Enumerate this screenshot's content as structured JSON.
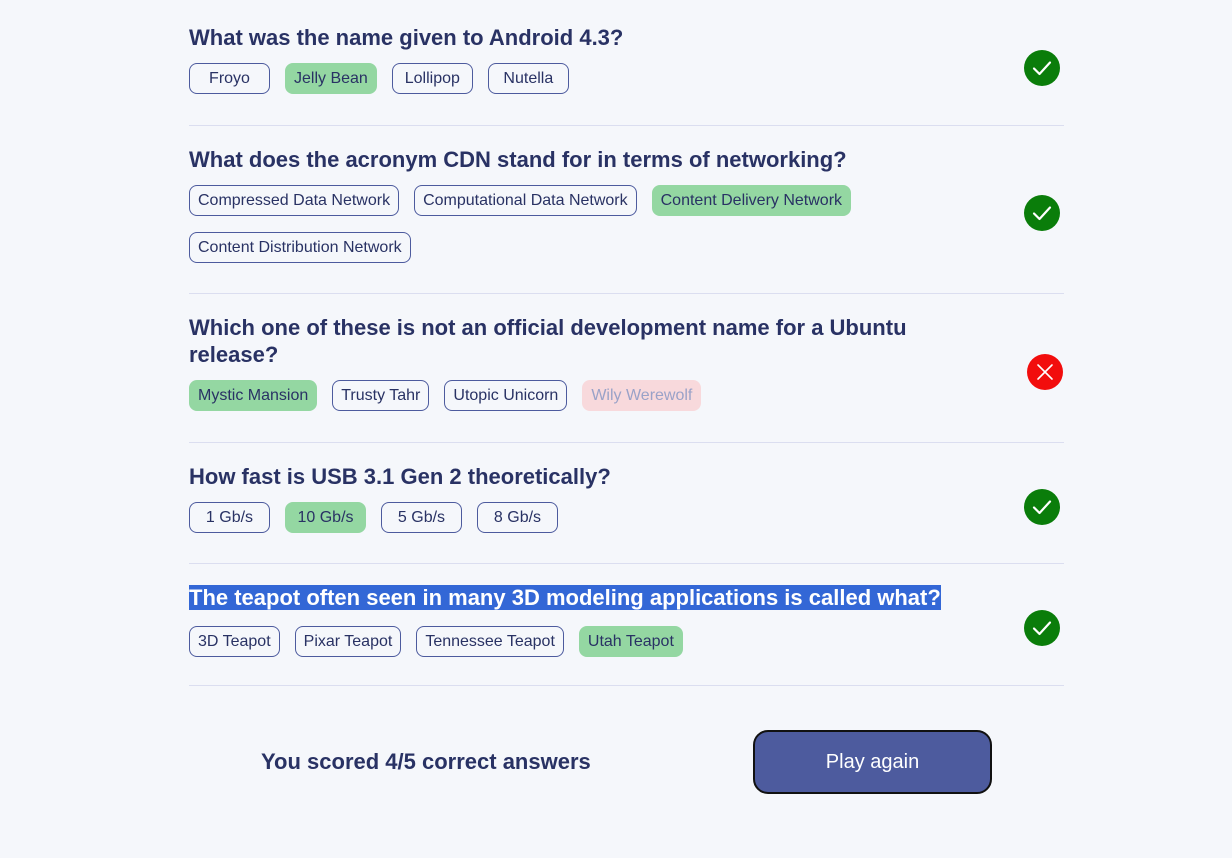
{
  "questions": [
    {
      "text": "What was the name given to Android 4.3?",
      "answers": [
        "Froyo",
        "Jelly Bean",
        "Lollipop",
        "Nutella"
      ],
      "correct_answer": "Jelly Bean",
      "result": "correct",
      "status_icon": "checkmark-icon"
    },
    {
      "text": "What does the acronym CDN stand for in terms of networking?",
      "answers": [
        "Compressed Data Network",
        "Computational Data Network",
        "Content Delivery Network",
        "Content Distribution Network"
      ],
      "correct_answer": "Content Delivery Network",
      "result": "correct",
      "status_icon": "checkmark-icon"
    },
    {
      "text": "Which one of these is not an official development name for a Ubuntu release?",
      "answers": [
        "Mystic Mansion",
        "Trusty Tahr",
        "Utopic Unicorn",
        "Wily Werewolf"
      ],
      "correct_answer": "Mystic Mansion",
      "wrong_answer": "Wily Werewolf",
      "result": "incorrect",
      "status_icon": "cross-icon"
    },
    {
      "text": "How fast is USB 3.1 Gen 2 theoretically?",
      "answers": [
        "1 Gb/s",
        "10 Gb/s",
        "5 Gb/s",
        "8 Gb/s"
      ],
      "correct_answer": "10 Gb/s",
      "result": "correct",
      "status_icon": "checkmark-icon"
    },
    {
      "text": "The teapot often seen in many 3D modeling applications is called what?",
      "answers": [
        "3D Teapot",
        "Pixar Teapot",
        "Tennessee Teapot",
        "Utah Teapot"
      ],
      "correct_answer": "Utah Teapot",
      "result": "correct",
      "status_icon": "checkmark-icon",
      "text_selected": true
    }
  ],
  "footer": {
    "score_text": "You scored 4/5 correct answers",
    "play_again_label": "Play again"
  },
  "colors": {
    "background": "#f5f7fb",
    "text": "#293264",
    "accent": "#4d5b9e",
    "correct_answer": "#94d7a2",
    "wrong_answer": "#f8d9dc",
    "status_correct": "#0a7d0a",
    "status_incorrect": "#f20d0d",
    "selection": "#3367d6"
  }
}
